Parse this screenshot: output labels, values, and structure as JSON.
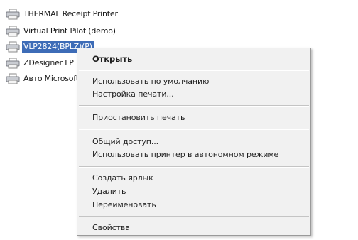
{
  "printers": [
    {
      "label": "THERMAL Receipt Printer",
      "icon": "printer-icon"
    },
    {
      "label": "Virtual Print Pilot (demo)",
      "icon": "printer-icon"
    },
    {
      "label": "VLP2824(BPLZ)(P)",
      "icon": "printer-icon",
      "selected": true,
      "highlight_color": "#3d6cb7"
    },
    {
      "label": "ZDesigner LP",
      "icon": "printer-icon"
    },
    {
      "label": "Авто Microsoft",
      "icon": "printer-icon"
    }
  ],
  "context_menu": {
    "items": {
      "open": "Открыть",
      "set_default": "Использовать по умолчанию",
      "print_settings": "Настройка печати...",
      "pause_printing": "Приостановить печать",
      "sharing": "Общий доступ...",
      "use_offline": "Использовать принтер в автономном режиме",
      "create_shortcut": "Создать ярлык",
      "delete": "Удалить",
      "rename": "Переименовать",
      "properties": "Свойства"
    }
  }
}
